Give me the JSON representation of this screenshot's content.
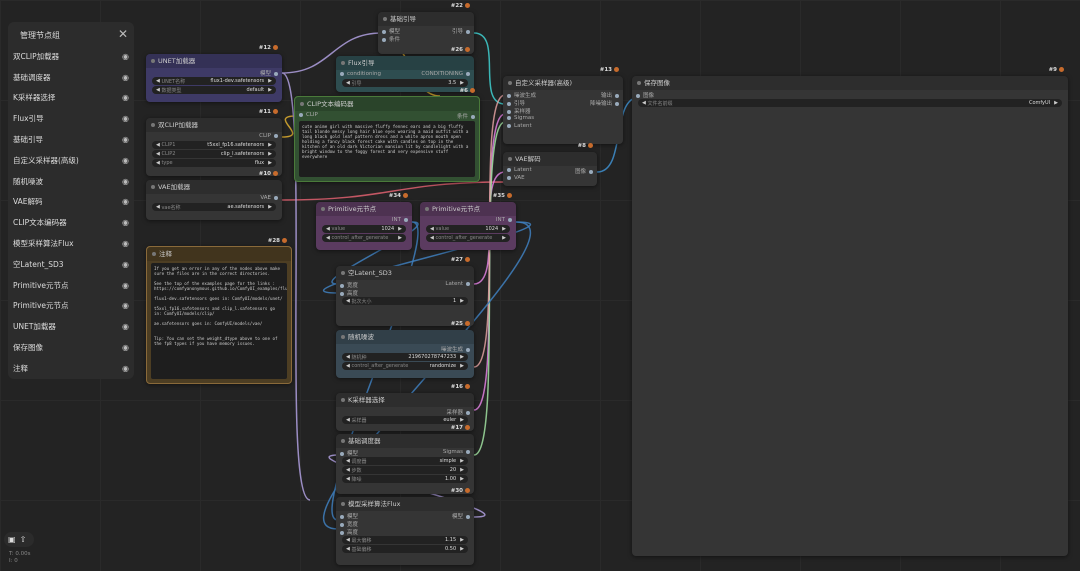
{
  "panel": {
    "title": "管理节点组",
    "items": [
      "双CLIP加载器",
      "基础调度器",
      "K采样器选择",
      "Flux引导",
      "基础引导",
      "自定义采样器(高级)",
      "随机噪波",
      "VAE解码",
      "CLIP文本编码器",
      "模型采样算法Flux",
      "空Latent_SD3",
      "Primitive元节点",
      "Primitive元节点",
      "UNET加载器",
      "保存图像",
      "注释"
    ]
  },
  "status": {
    "time": "T: 0.00s",
    "iter": "I: 0"
  },
  "icons": {
    "close": "close-icon",
    "eye": "eye-icon",
    "save": "save-icon",
    "upload": "upload-icon",
    "badge": "fox-icon"
  },
  "colors": {
    "background": "#232323",
    "node": "#353535",
    "unet": "#3e3a66",
    "flux_guidance": "#2e4d50",
    "clip_text": "#325032",
    "primitive": "#5b3b60",
    "note": "#4d3e23",
    "noise": "#3a4a55",
    "link_vae": "#e06070",
    "link_model": "#b0a0e0",
    "link_latent": "#e080e0",
    "link_cond": "#e0b030",
    "link_guider": "#40d0d0"
  },
  "nodes": [
    {
      "id": "#22",
      "title": "基础引导",
      "inputs": [
        "模型",
        "条件"
      ],
      "outputs": [
        "引导"
      ],
      "widgets": []
    },
    {
      "id": "#26",
      "title": "Flux引导",
      "inputs": [
        "conditioning"
      ],
      "outputs": [
        "CONDITIONING"
      ],
      "widgets": [
        {
          "label": "引导",
          "value": "3.5"
        }
      ]
    },
    {
      "id": "#12",
      "title": "UNET加载器",
      "inputs": [],
      "outputs": [
        "模型"
      ],
      "widgets": [
        {
          "label": "UNET名称",
          "value": "flux1-dev.safetensors"
        },
        {
          "label": "数据类型",
          "value": "default"
        }
      ]
    },
    {
      "id": "#6",
      "title": "CLIP文本编码器",
      "inputs": [
        "CLIP"
      ],
      "outputs": [
        "条件"
      ],
      "widgets": [],
      "text": "cute anime girl with massive fluffy fennec ears and a big fluffy tail blonde messy long hair blue eyes wearing a maid outfit with a long black gold leaf pattern dress and a white apron mouth open holding a fancy black forest cake with candles on top in the kitchen of an old dark Victorian mansion lit by candlelight with a bright window to the foggy forest and very expensive stuff everywhere"
    },
    {
      "id": "#11",
      "title": "双CLIP加载器",
      "inputs": [],
      "outputs": [
        "CLIP"
      ],
      "widgets": [
        {
          "label": "CLIP1",
          "value": "t5xxl_fp16.safetensors"
        },
        {
          "label": "CLIP2",
          "value": "clip_l.safetensors"
        },
        {
          "label": "type",
          "value": "flux"
        }
      ]
    },
    {
      "id": "#10",
      "title": "VAE加载器",
      "inputs": [],
      "outputs": [
        "VAE"
      ],
      "widgets": [
        {
          "label": "vae名称",
          "value": "ae.safetensors"
        }
      ]
    },
    {
      "id": "#28",
      "title": "注释",
      "inputs": [],
      "outputs": [],
      "widgets": [],
      "text": "If you get an error in any of the nodes above make sure the files are in the correct directories.\n\nSee the top of the examples page for the links : https://comfyanonymous.github.io/ComfyUI_examples/flux/\n\nflux1-dev.safetensors goes in: ComfyUI/models/unet/\n\nt5xxl_fp16.safetensors and clip_l.safetensors go in: ComfyUI/models/clip/\n\nae.safetensors goes in: ComfyUI/models/vae/\n\n\nTip: You can set the weight_dtype above to one of the fp8 types if you have memory issues."
    },
    {
      "id": "#34",
      "title": "Primitive元节点",
      "inputs": [],
      "outputs": [
        "INT"
      ],
      "widgets": [
        {
          "label": "value",
          "value": "1024"
        },
        {
          "label": "control_after_generate",
          "value": ""
        }
      ]
    },
    {
      "id": "#35",
      "title": "Primitive元节点",
      "inputs": [],
      "outputs": [
        "INT"
      ],
      "widgets": [
        {
          "label": "value",
          "value": "1024"
        },
        {
          "label": "control_after_generate",
          "value": ""
        }
      ]
    },
    {
      "id": "#27",
      "title": "空Latent_SD3",
      "inputs": [
        "宽度",
        "高度"
      ],
      "outputs": [
        "Latent"
      ],
      "widgets": [
        {
          "label": "批次大小",
          "value": "1"
        }
      ]
    },
    {
      "id": "#25",
      "title": "随机噪波",
      "inputs": [],
      "outputs": [
        "噪波生成"
      ],
      "widgets": [
        {
          "label": "随机种",
          "value": "219670278747233"
        },
        {
          "label": "control_after_generate",
          "value": "randomize"
        }
      ]
    },
    {
      "id": "#16",
      "title": "K采样器选择",
      "inputs": [],
      "outputs": [
        "采样器"
      ],
      "widgets": [
        {
          "label": "采样器",
          "value": "euler"
        }
      ]
    },
    {
      "id": "#17",
      "title": "基础调度器",
      "inputs": [
        "模型"
      ],
      "outputs": [
        "Sigmas"
      ],
      "widgets": [
        {
          "label": "调度器",
          "value": "simple"
        },
        {
          "label": "步数",
          "value": "20"
        },
        {
          "label": "降噪",
          "value": "1.00"
        }
      ]
    },
    {
      "id": "#30",
      "title": "模型采样算法Flux",
      "inputs": [
        "模型",
        "宽度",
        "高度"
      ],
      "outputs": [
        "模型"
      ],
      "widgets": [
        {
          "label": "最大偏移",
          "value": "1.15"
        },
        {
          "label": "基础偏移",
          "value": "0.50"
        }
      ]
    },
    {
      "id": "#13",
      "title": "自定义采样器(高级)",
      "inputs": [
        "噪波生成",
        "引导",
        "采样器",
        "Sigmas",
        "Latent"
      ],
      "outputs": [
        "输出",
        "降噪输出"
      ],
      "widgets": []
    },
    {
      "id": "#8",
      "title": "VAE解码",
      "inputs": [
        "Latent",
        "VAE"
      ],
      "outputs": [
        "图像"
      ],
      "widgets": []
    },
    {
      "id": "#9",
      "title": "保存图像",
      "inputs": [
        "图像"
      ],
      "outputs": [],
      "widgets": [
        {
          "label": "文件名前缀",
          "value": "ComfyUI"
        }
      ]
    }
  ]
}
